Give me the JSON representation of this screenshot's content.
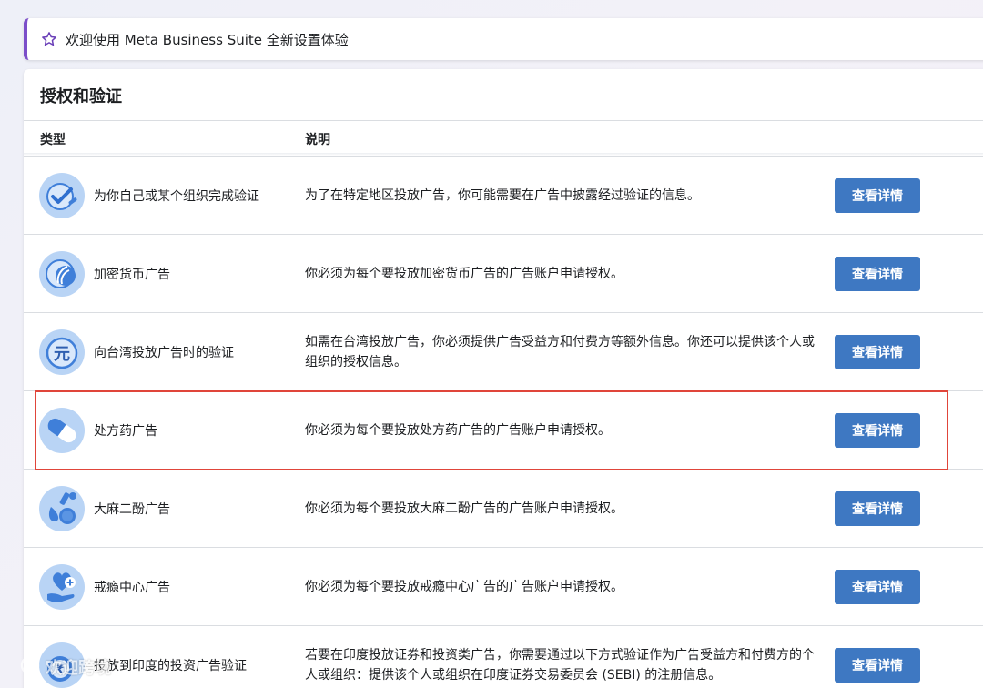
{
  "banner": {
    "icon": "star-outline-icon",
    "text": "欢迎使用 Meta Business Suite 全新设置体验"
  },
  "card": {
    "title": "授权和验证",
    "columns": {
      "type": "类型",
      "description": "说明"
    },
    "rows": [
      {
        "icon": "verify-check-icon",
        "type": "为你自己或某个组织完成验证",
        "description": "为了在特定地区投放广告，你可能需要在广告中披露经过验证的信息。",
        "button": "查看详情"
      },
      {
        "icon": "crypto-coin-icon",
        "type": "加密货币广告",
        "description": "你必须为每个要投放加密货币广告的广告账户申请授权。",
        "button": "查看详情"
      },
      {
        "icon": "yuan-coin-icon",
        "type": "向台湾投放广告时的验证",
        "description": "如需在台湾投放广告，你必须提供广告受益方和付费方等额外信息。你还可以提供该个人或组织的授权信息。",
        "button": "查看详情"
      },
      {
        "icon": "pill-capsule-icon",
        "type": "处方药广告",
        "description": "你必须为每个要投放处方药广告的广告账户申请授权。",
        "button": "查看详情"
      },
      {
        "icon": "cannabis-drop-icon",
        "type": "大麻二酚广告",
        "description": "你必须为每个要投放大麻二酚广告的广告账户申请授权。",
        "button": "查看详情"
      },
      {
        "icon": "heart-hand-icon",
        "type": "戒瘾中心广告",
        "description": "你必须为每个要投放戒瘾中心广告的广告账户申请授权。",
        "button": "查看详情"
      },
      {
        "icon": "rupee-coin-icon",
        "type": "投放到印度的投资广告验证",
        "description": "若要在印度投放证券和投资类广告，你需要通过以下方式验证作为广告受益方和付费方的个人或组织：提供该个人或组织在印度证券交易委员会 (SEBI) 的注册信息。",
        "button": "查看详情"
      }
    ]
  },
  "watermark": {
    "text": "欢迎跨境"
  },
  "colors": {
    "accent_purple": "#7b4ec9",
    "button_blue": "#3e78c2",
    "highlight_red": "#e0453a",
    "icon_light_blue": "#b9d4f5",
    "icon_blue": "#3f7fd9"
  }
}
